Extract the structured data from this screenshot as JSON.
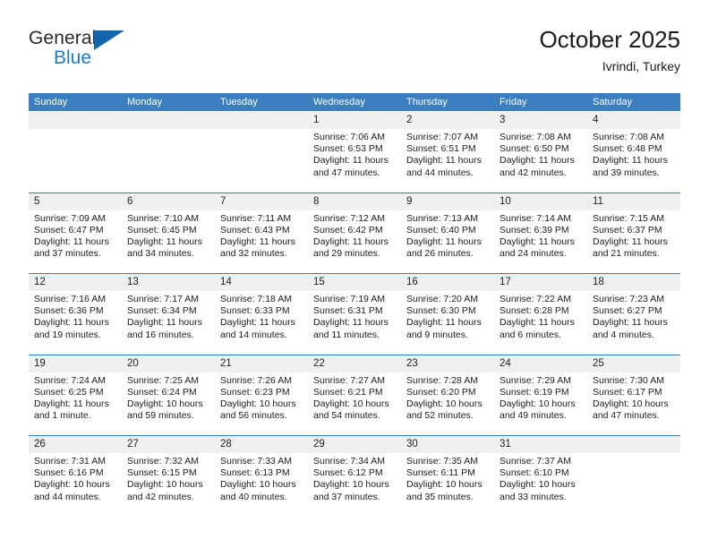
{
  "brand": {
    "line1": "General",
    "line2": "Blue",
    "triangle_color": "#1365ad",
    "blue_color": "#1b7ad0"
  },
  "header": {
    "title": "October 2025",
    "subtitle": "Ivrindi, Turkey"
  },
  "theme": {
    "header_blue": "#3c7fc1",
    "day_band_gray": "#f0f0f0",
    "separator_blue": "#3c7fc1"
  },
  "weekdays": [
    "Sunday",
    "Monday",
    "Tuesday",
    "Wednesday",
    "Thursday",
    "Friday",
    "Saturday"
  ],
  "weeks": [
    [
      {
        "day": "",
        "empty": true,
        "lines": []
      },
      {
        "day": "",
        "empty": true,
        "lines": []
      },
      {
        "day": "",
        "empty": true,
        "lines": []
      },
      {
        "day": "1",
        "empty": false,
        "lines": [
          "Sunrise: 7:06 AM",
          "Sunset: 6:53 PM",
          "Daylight: 11 hours",
          "and 47 minutes."
        ]
      },
      {
        "day": "2",
        "empty": false,
        "lines": [
          "Sunrise: 7:07 AM",
          "Sunset: 6:51 PM",
          "Daylight: 11 hours",
          "and 44 minutes."
        ]
      },
      {
        "day": "3",
        "empty": false,
        "lines": [
          "Sunrise: 7:08 AM",
          "Sunset: 6:50 PM",
          "Daylight: 11 hours",
          "and 42 minutes."
        ]
      },
      {
        "day": "4",
        "empty": false,
        "lines": [
          "Sunrise: 7:08 AM",
          "Sunset: 6:48 PM",
          "Daylight: 11 hours",
          "and 39 minutes."
        ]
      }
    ],
    [
      {
        "day": "5",
        "empty": false,
        "lines": [
          "Sunrise: 7:09 AM",
          "Sunset: 6:47 PM",
          "Daylight: 11 hours",
          "and 37 minutes."
        ]
      },
      {
        "day": "6",
        "empty": false,
        "lines": [
          "Sunrise: 7:10 AM",
          "Sunset: 6:45 PM",
          "Daylight: 11 hours",
          "and 34 minutes."
        ]
      },
      {
        "day": "7",
        "empty": false,
        "lines": [
          "Sunrise: 7:11 AM",
          "Sunset: 6:43 PM",
          "Daylight: 11 hours",
          "and 32 minutes."
        ]
      },
      {
        "day": "8",
        "empty": false,
        "lines": [
          "Sunrise: 7:12 AM",
          "Sunset: 6:42 PM",
          "Daylight: 11 hours",
          "and 29 minutes."
        ]
      },
      {
        "day": "9",
        "empty": false,
        "lines": [
          "Sunrise: 7:13 AM",
          "Sunset: 6:40 PM",
          "Daylight: 11 hours",
          "and 26 minutes."
        ]
      },
      {
        "day": "10",
        "empty": false,
        "lines": [
          "Sunrise: 7:14 AM",
          "Sunset: 6:39 PM",
          "Daylight: 11 hours",
          "and 24 minutes."
        ]
      },
      {
        "day": "11",
        "empty": false,
        "lines": [
          "Sunrise: 7:15 AM",
          "Sunset: 6:37 PM",
          "Daylight: 11 hours",
          "and 21 minutes."
        ]
      }
    ],
    [
      {
        "day": "12",
        "empty": false,
        "lines": [
          "Sunrise: 7:16 AM",
          "Sunset: 6:36 PM",
          "Daylight: 11 hours",
          "and 19 minutes."
        ]
      },
      {
        "day": "13",
        "empty": false,
        "lines": [
          "Sunrise: 7:17 AM",
          "Sunset: 6:34 PM",
          "Daylight: 11 hours",
          "and 16 minutes."
        ]
      },
      {
        "day": "14",
        "empty": false,
        "lines": [
          "Sunrise: 7:18 AM",
          "Sunset: 6:33 PM",
          "Daylight: 11 hours",
          "and 14 minutes."
        ]
      },
      {
        "day": "15",
        "empty": false,
        "lines": [
          "Sunrise: 7:19 AM",
          "Sunset: 6:31 PM",
          "Daylight: 11 hours",
          "and 11 minutes."
        ]
      },
      {
        "day": "16",
        "empty": false,
        "lines": [
          "Sunrise: 7:20 AM",
          "Sunset: 6:30 PM",
          "Daylight: 11 hours",
          "and 9 minutes."
        ]
      },
      {
        "day": "17",
        "empty": false,
        "lines": [
          "Sunrise: 7:22 AM",
          "Sunset: 6:28 PM",
          "Daylight: 11 hours",
          "and 6 minutes."
        ]
      },
      {
        "day": "18",
        "empty": false,
        "lines": [
          "Sunrise: 7:23 AM",
          "Sunset: 6:27 PM",
          "Daylight: 11 hours",
          "and 4 minutes."
        ]
      }
    ],
    [
      {
        "day": "19",
        "empty": false,
        "lines": [
          "Sunrise: 7:24 AM",
          "Sunset: 6:25 PM",
          "Daylight: 11 hours",
          "and 1 minute."
        ]
      },
      {
        "day": "20",
        "empty": false,
        "lines": [
          "Sunrise: 7:25 AM",
          "Sunset: 6:24 PM",
          "Daylight: 10 hours",
          "and 59 minutes."
        ]
      },
      {
        "day": "21",
        "empty": false,
        "lines": [
          "Sunrise: 7:26 AM",
          "Sunset: 6:23 PM",
          "Daylight: 10 hours",
          "and 56 minutes."
        ]
      },
      {
        "day": "22",
        "empty": false,
        "lines": [
          "Sunrise: 7:27 AM",
          "Sunset: 6:21 PM",
          "Daylight: 10 hours",
          "and 54 minutes."
        ]
      },
      {
        "day": "23",
        "empty": false,
        "lines": [
          "Sunrise: 7:28 AM",
          "Sunset: 6:20 PM",
          "Daylight: 10 hours",
          "and 52 minutes."
        ]
      },
      {
        "day": "24",
        "empty": false,
        "lines": [
          "Sunrise: 7:29 AM",
          "Sunset: 6:19 PM",
          "Daylight: 10 hours",
          "and 49 minutes."
        ]
      },
      {
        "day": "25",
        "empty": false,
        "lines": [
          "Sunrise: 7:30 AM",
          "Sunset: 6:17 PM",
          "Daylight: 10 hours",
          "and 47 minutes."
        ]
      }
    ],
    [
      {
        "day": "26",
        "empty": false,
        "lines": [
          "Sunrise: 7:31 AM",
          "Sunset: 6:16 PM",
          "Daylight: 10 hours",
          "and 44 minutes."
        ]
      },
      {
        "day": "27",
        "empty": false,
        "lines": [
          "Sunrise: 7:32 AM",
          "Sunset: 6:15 PM",
          "Daylight: 10 hours",
          "and 42 minutes."
        ]
      },
      {
        "day": "28",
        "empty": false,
        "lines": [
          "Sunrise: 7:33 AM",
          "Sunset: 6:13 PM",
          "Daylight: 10 hours",
          "and 40 minutes."
        ]
      },
      {
        "day": "29",
        "empty": false,
        "lines": [
          "Sunrise: 7:34 AM",
          "Sunset: 6:12 PM",
          "Daylight: 10 hours",
          "and 37 minutes."
        ]
      },
      {
        "day": "30",
        "empty": false,
        "lines": [
          "Sunrise: 7:35 AM",
          "Sunset: 6:11 PM",
          "Daylight: 10 hours",
          "and 35 minutes."
        ]
      },
      {
        "day": "31",
        "empty": false,
        "lines": [
          "Sunrise: 7:37 AM",
          "Sunset: 6:10 PM",
          "Daylight: 10 hours",
          "and 33 minutes."
        ]
      },
      {
        "day": "",
        "empty": true,
        "lines": []
      }
    ]
  ]
}
